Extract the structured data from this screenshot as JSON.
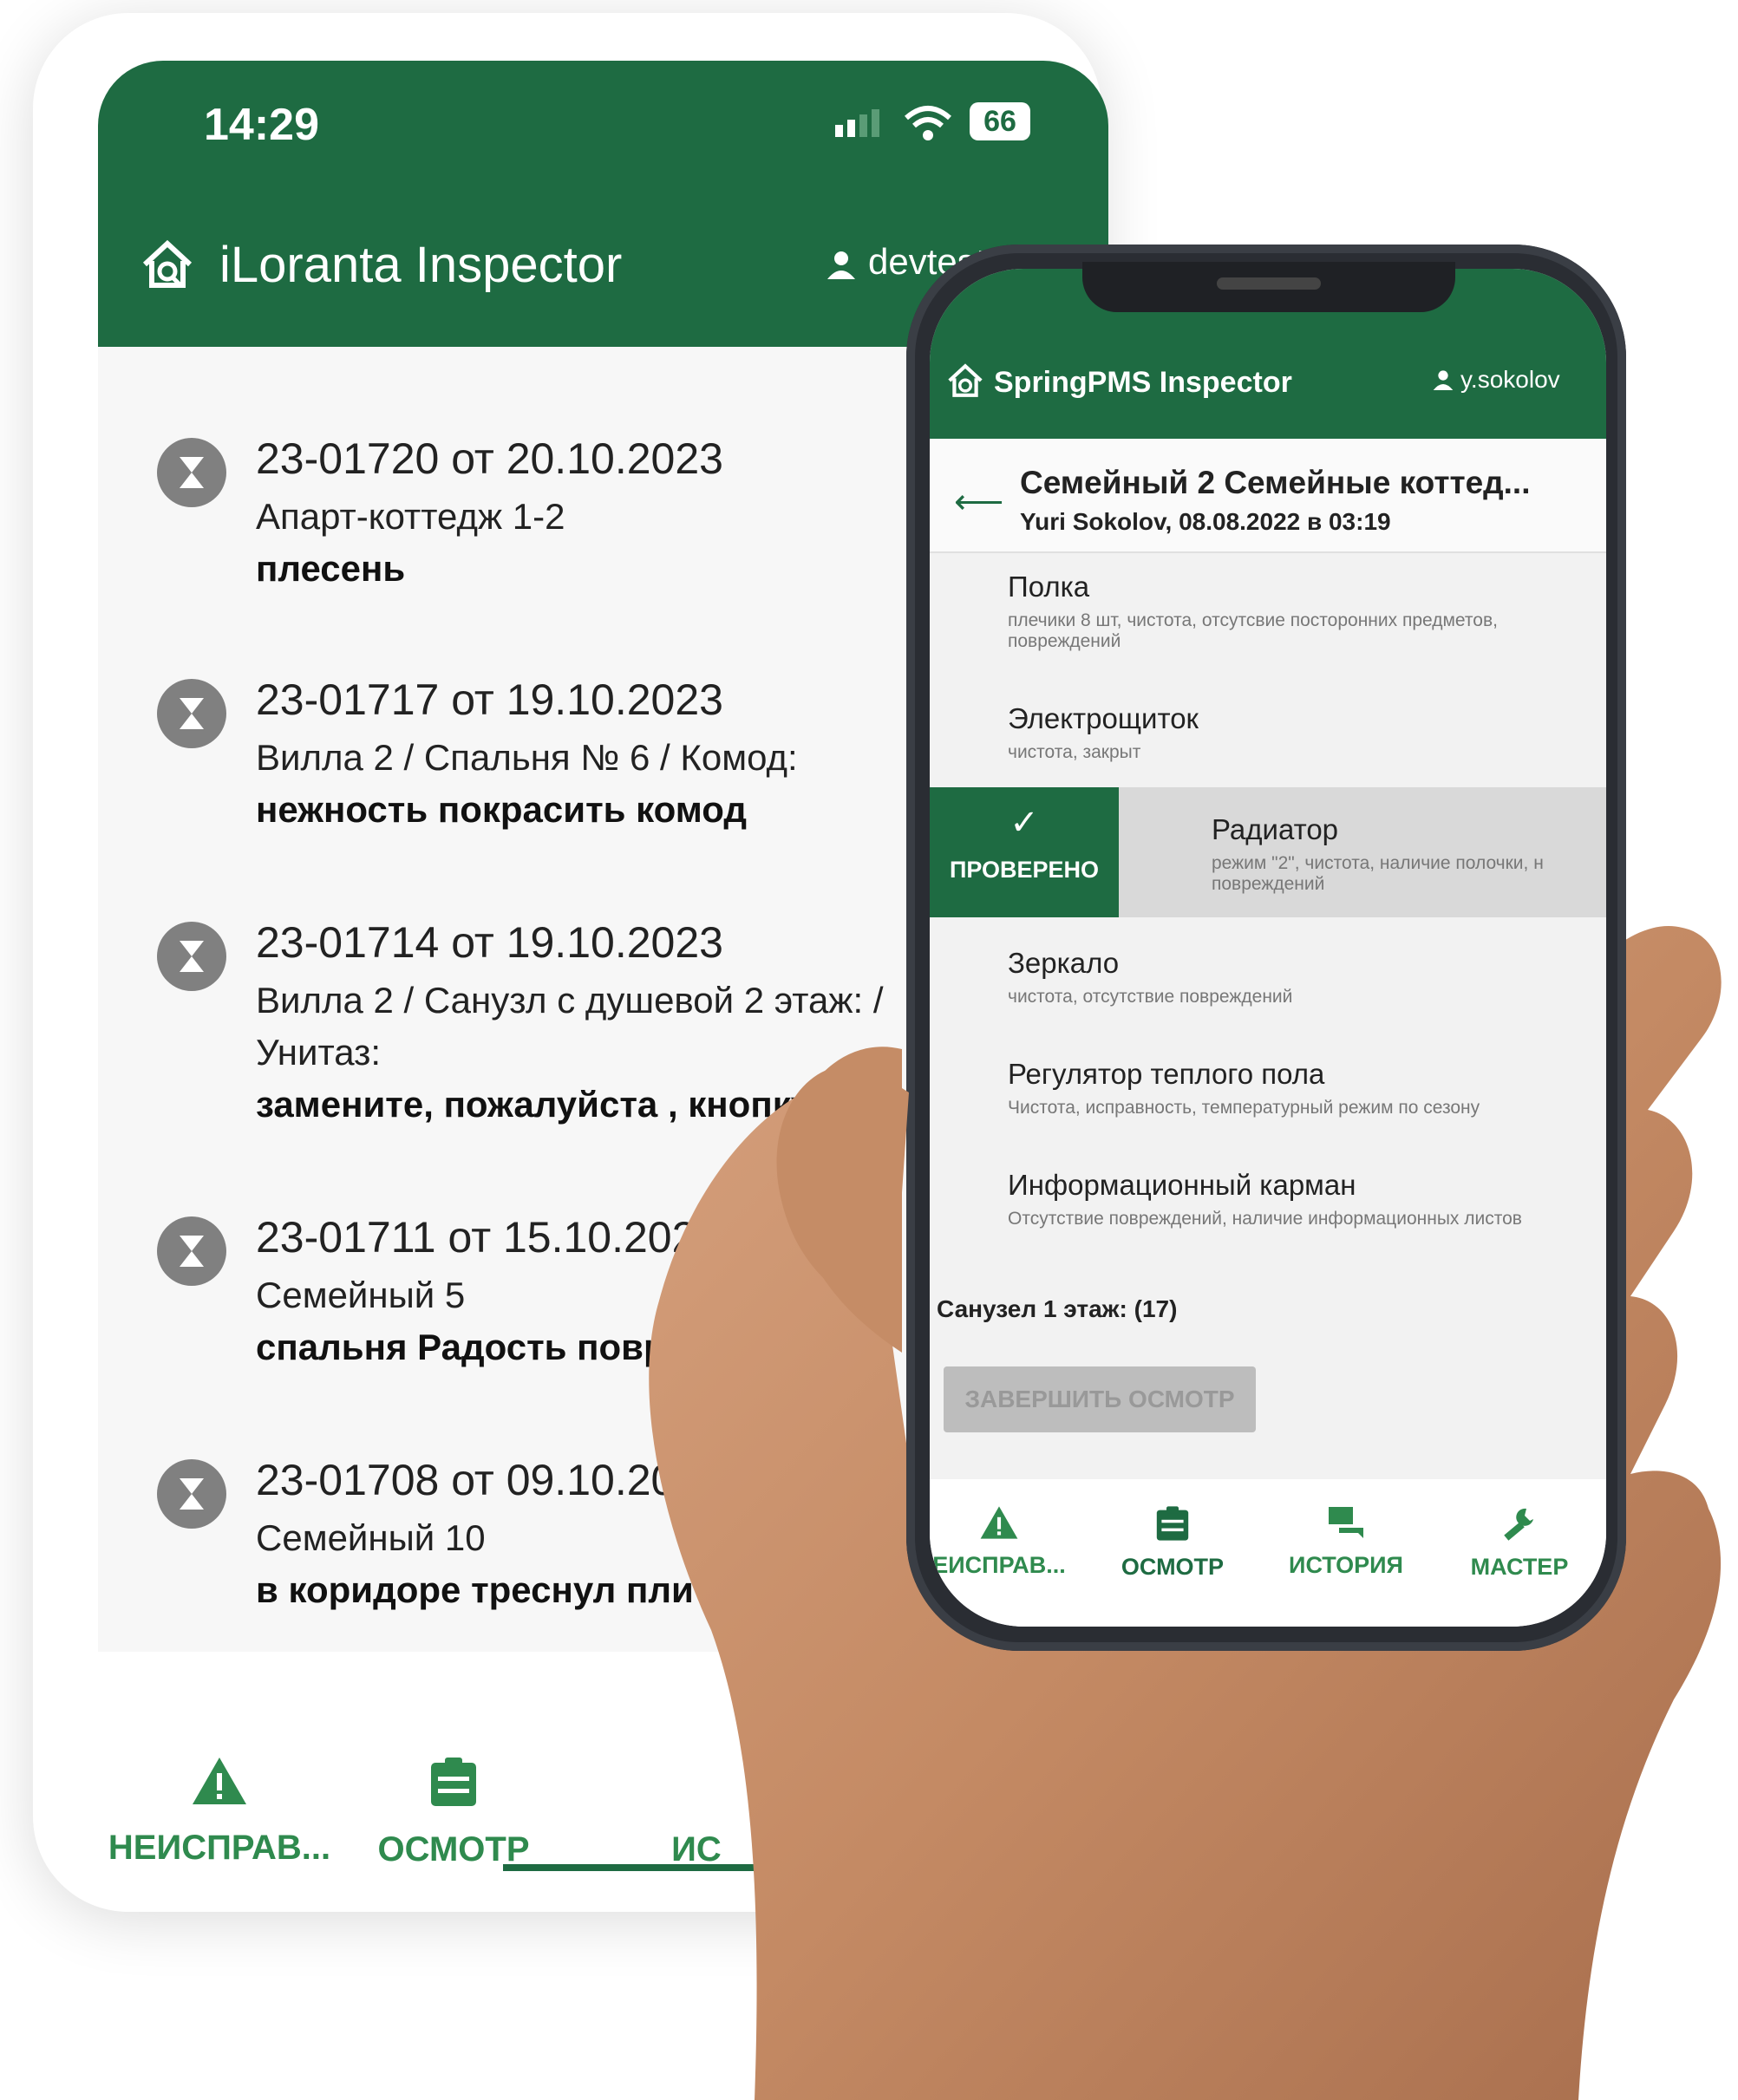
{
  "back_app": {
    "status_time": "14:29",
    "battery": "66",
    "title": "iLoranta Inspector",
    "user": "devtester",
    "issues": [
      {
        "number": "23-01720 от 20.10.2023",
        "location": "Апарт-коттедж 1-2",
        "description": "плесень"
      },
      {
        "number": "23-01717 от 19.10.2023",
        "location": "Вилла 2 / Спальня № 6 / Комод:",
        "description": "нежность покрасить комод"
      },
      {
        "number": "23-01714 от 19.10.2023",
        "location": "Вилла 2 / Санузл с душевой 2 этаж: / Унитаз:",
        "description": "замените, пожалуйста , кнопку"
      },
      {
        "number": "23-01711 от 15.10.2023",
        "location": "Семейный 5",
        "description": "спальня Радость повреж"
      },
      {
        "number": "23-01708 от 09.10.2023",
        "location": "Семейный 10",
        "description": "в коридоре треснул плит"
      }
    ],
    "nav": [
      {
        "label": "НЕИСПРАВ...",
        "icon": "warning-icon"
      },
      {
        "label": "ОСМОТР",
        "icon": "clipboard-icon"
      },
      {
        "label": "ИС",
        "icon": "history-icon"
      }
    ]
  },
  "front_app": {
    "title": "SpringPMS Inspector",
    "user": "y.sokolov",
    "header_title": "Семейный 2 Семейные коттед...",
    "header_subtitle": "Yuri Sokolov, 08.08.2022 в 03:19",
    "items": [
      {
        "name": "Полка",
        "desc": "плечики 8 шт, чистота, отсутсвие посторонних предметов, повреждений"
      },
      {
        "name": "Электрощиток",
        "desc": "чистота, закрыт"
      },
      {
        "name": "Зеркало",
        "desc": "чистота, отсутствие повреждений"
      },
      {
        "name": "Регулятор теплого пола",
        "desc": "Чистота, исправность, температурный режим по сезону"
      },
      {
        "name": "Информационный карман",
        "desc": "Отсутствие повреждений, наличие информационных листов"
      }
    ],
    "checked_item": {
      "badge": "ПРОВЕРЕНО",
      "name": "Радиатор",
      "desc": "режим \"2\", чистота, наличие полочки, н повреждений"
    },
    "section": "Санузел 1 этаж: (17)",
    "finish_button": "ЗАВЕРШИТЬ ОСМОТР",
    "nav": [
      {
        "label": "ЕИСПРАВ...",
        "icon": "warning-icon"
      },
      {
        "label": "ОСМОТР",
        "icon": "clipboard-icon"
      },
      {
        "label": "ИСТОРИЯ",
        "icon": "chat-icon"
      },
      {
        "label": "МАСТЕР",
        "icon": "wrench-icon"
      }
    ]
  },
  "colors": {
    "brand_green": "#1e6b42",
    "nav_green": "#2f8a4e"
  }
}
